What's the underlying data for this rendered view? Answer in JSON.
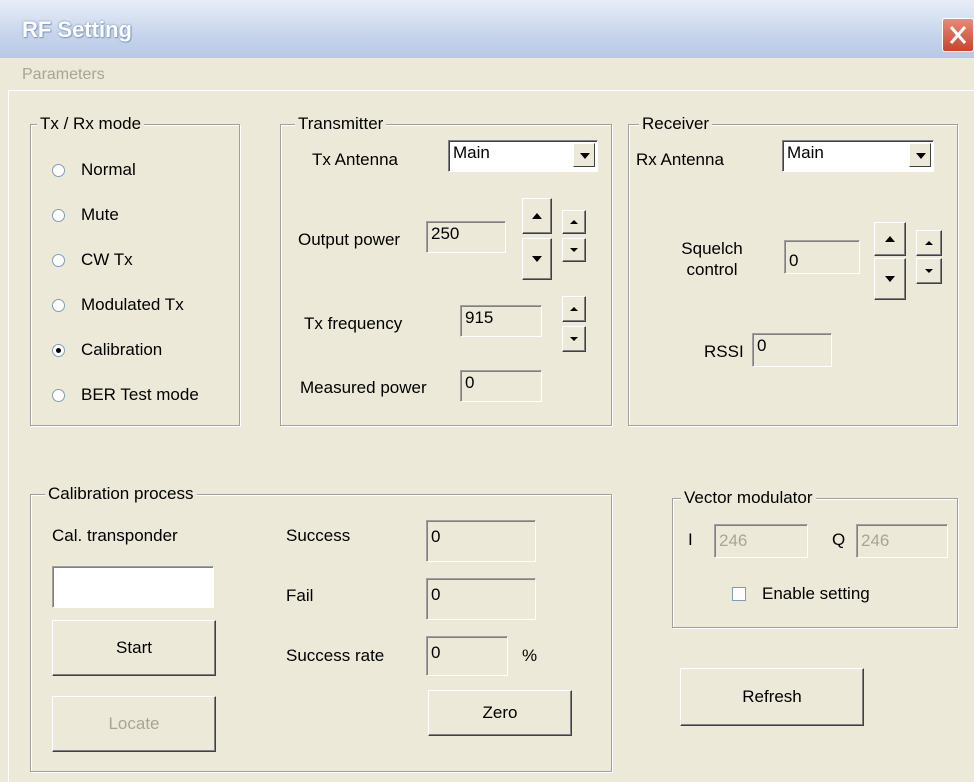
{
  "window": {
    "title": "RF Setting",
    "close_icon": "close-icon"
  },
  "menu": {
    "items": [
      "Parameters"
    ]
  },
  "txrx_mode": {
    "legend": "Tx / Rx mode",
    "options": [
      {
        "label": "Normal",
        "checked": false
      },
      {
        "label": "Mute",
        "checked": false
      },
      {
        "label": "CW Tx",
        "checked": false
      },
      {
        "label": "Modulated Tx",
        "checked": false
      },
      {
        "label": "Calibration",
        "checked": true
      },
      {
        "label": "BER Test mode",
        "checked": false
      }
    ]
  },
  "transmitter": {
    "legend": "Transmitter",
    "antenna_label": "Tx Antenna",
    "antenna_value": "Main",
    "output_power_label": "Output power",
    "output_power_value": "250",
    "frequency_label": "Tx frequency",
    "frequency_value": "915",
    "measured_power_label": "Measured power",
    "measured_power_value": "0"
  },
  "receiver": {
    "legend": "Receiver",
    "antenna_label": "Rx Antenna",
    "antenna_value": "Main",
    "squelch_label": "Squelch control",
    "squelch_value": "0",
    "rssi_label": "RSSI",
    "rssi_value": "0"
  },
  "calibration": {
    "legend": "Calibration process",
    "transponder_label": "Cal. transponder",
    "transponder_value": "",
    "start_label": "Start",
    "locate_label": "Locate",
    "success_label": "Success",
    "success_value": "0",
    "fail_label": "Fail",
    "fail_value": "0",
    "rate_label": "Success rate",
    "rate_value": "0",
    "rate_unit": "%",
    "zero_label": "Zero"
  },
  "vector_modulator": {
    "legend": "Vector modulator",
    "i_label": "I",
    "i_value": "246",
    "q_label": "Q",
    "q_value": "246",
    "enable_label": "Enable setting",
    "enable_checked": false
  },
  "refresh_label": "Refresh"
}
